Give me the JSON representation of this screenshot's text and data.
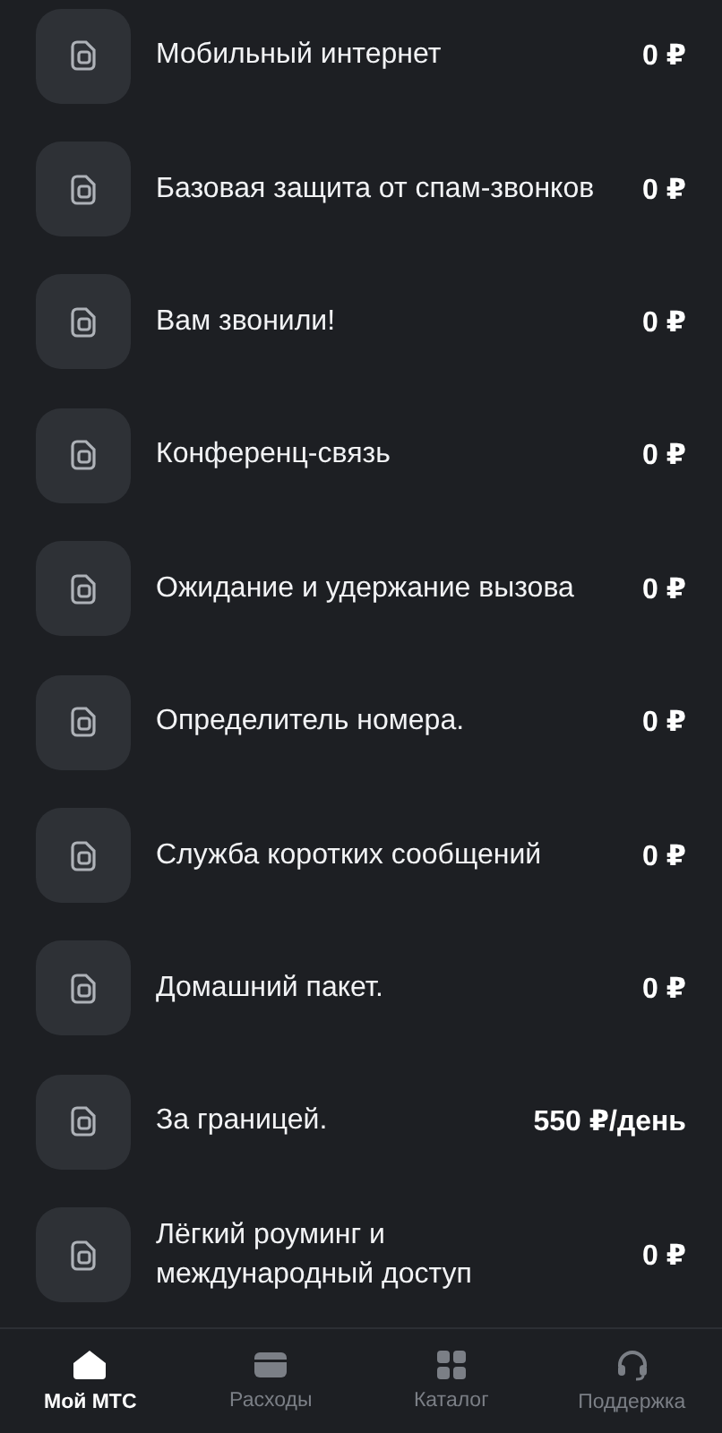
{
  "services": [
    {
      "name": "Мобильный интернет",
      "price": "0 ₽"
    },
    {
      "name": "Базовая защита от спам-звонков",
      "price": "0 ₽"
    },
    {
      "name": "Вам звонили!",
      "price": "0 ₽"
    },
    {
      "name": "Конференц-связь",
      "price": "0 ₽"
    },
    {
      "name": "Ожидание и удержание вызова",
      "price": "0 ₽"
    },
    {
      "name": "Определитель номера.",
      "price": "0 ₽"
    },
    {
      "name": "Служба коротких сообщений",
      "price": "0 ₽"
    },
    {
      "name": "Домашний пакет.",
      "price": "0 ₽"
    },
    {
      "name": "За границей.",
      "price": "550 ₽/день"
    },
    {
      "name": "Лёгкий роуминг и международный доступ",
      "price": "0 ₽"
    }
  ],
  "bottom_nav": [
    {
      "label": "Мой МТС",
      "kind": "home",
      "selected": true
    },
    {
      "label": "Расходы",
      "kind": "wallet",
      "selected": false
    },
    {
      "label": "Каталог",
      "kind": "grid",
      "selected": false
    },
    {
      "label": "Поддержка",
      "kind": "headset",
      "selected": false
    }
  ]
}
